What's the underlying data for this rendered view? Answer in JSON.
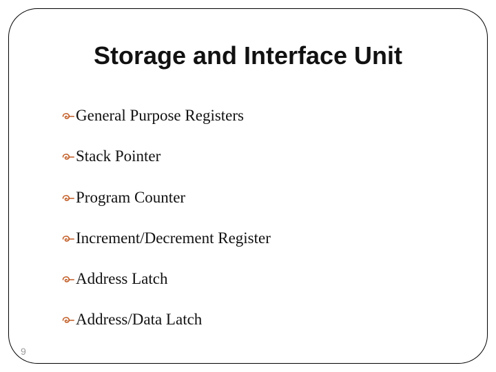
{
  "title": "Storage and Interface Unit",
  "bullets": {
    "items": [
      {
        "text": "General Purpose Registers"
      },
      {
        "text": "Stack Pointer"
      },
      {
        "text": "Program Counter"
      },
      {
        "text": "Increment/Decrement Register"
      },
      {
        "text": "Address Latch"
      },
      {
        "text": "Address/Data Latch"
      }
    ],
    "glyph": "་"
  },
  "pageNumber": "9"
}
